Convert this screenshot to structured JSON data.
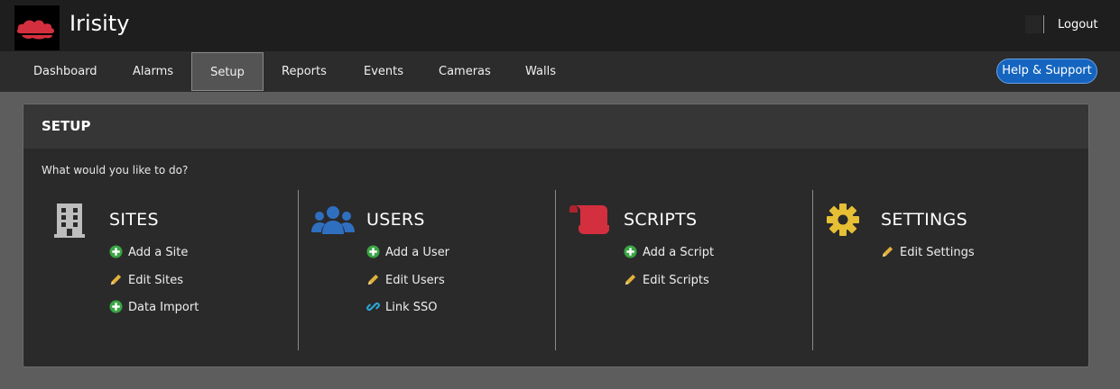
{
  "header": {
    "app_title": "Irisity",
    "logout_label": "Logout"
  },
  "nav": {
    "items": [
      {
        "label": "Dashboard"
      },
      {
        "label": "Alarms"
      },
      {
        "label": "Setup",
        "active": true
      },
      {
        "label": "Reports"
      },
      {
        "label": "Events"
      },
      {
        "label": "Cameras"
      },
      {
        "label": "Walls"
      }
    ],
    "help_label": "Help & Support"
  },
  "panel": {
    "title": "SETUP",
    "prompt": "What would you like to do?",
    "sections": [
      {
        "title": "SITES",
        "icon": "building-icon",
        "links": [
          {
            "label": "Add a Site",
            "icon": "plus-circle-icon"
          },
          {
            "label": "Edit Sites",
            "icon": "pencil-icon"
          },
          {
            "label": "Data Import",
            "icon": "plus-circle-icon"
          }
        ]
      },
      {
        "title": "USERS",
        "icon": "users-icon",
        "links": [
          {
            "label": "Add a User",
            "icon": "plus-circle-icon"
          },
          {
            "label": "Edit Users",
            "icon": "pencil-icon"
          },
          {
            "label": "Link SSO",
            "icon": "link-icon"
          }
        ]
      },
      {
        "title": "SCRIPTS",
        "icon": "scroll-icon",
        "links": [
          {
            "label": "Add a Script",
            "icon": "plus-circle-icon"
          },
          {
            "label": "Edit Scripts",
            "icon": "pencil-icon"
          }
        ]
      },
      {
        "title": "SETTINGS",
        "icon": "gear-icon",
        "links": [
          {
            "label": "Edit Settings",
            "icon": "pencil-icon"
          }
        ]
      }
    ]
  },
  "colors": {
    "brand_red": "#d32f3f",
    "help_blue": "#1565c0",
    "users_blue": "#2f6fc0",
    "plus_green": "#3aa544",
    "pencil_yellow": "#e2b13c",
    "link_cyan": "#2aa8d8",
    "gear_yellow": "#e6bf35"
  }
}
